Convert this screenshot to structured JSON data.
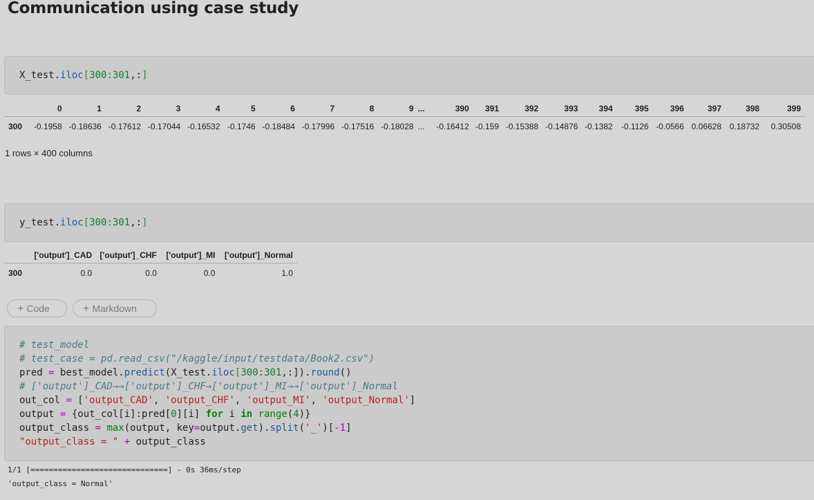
{
  "heading": "Communication using case study",
  "cell1": {
    "code": {
      "obj": "X_test.",
      "fn": "iloc",
      "lb": "[",
      "n1": "300",
      "c": ":",
      "n2": "301",
      "rest": ",:",
      "rb": "]"
    }
  },
  "table1": {
    "columns": [
      "",
      "0",
      "1",
      "2",
      "3",
      "4",
      "5",
      "6",
      "7",
      "8",
      "9",
      "...",
      "390",
      "391",
      "392",
      "393",
      "394",
      "395",
      "396",
      "397",
      "398",
      "399"
    ],
    "row_index": "300",
    "values": [
      "-0.1958",
      "-0.18636",
      "-0.17612",
      "-0.17044",
      "-0.16532",
      "-0.1746",
      "-0.18484",
      "-0.17996",
      "-0.17516",
      "-0.18028",
      "...",
      "-0.16412",
      "-0.159",
      "-0.15388",
      "-0.14876",
      "-0.1382",
      "-0.1126",
      "-0.0566",
      "0.06628",
      "0.18732",
      "0.30508"
    ],
    "shape": "1 rows × 400 columns"
  },
  "cell2": {
    "code": {
      "obj": "y_test.",
      "fn": "iloc",
      "lb": "[",
      "n1": "300",
      "c": ":",
      "n2": "301",
      "rest": ",:",
      "rb": "]"
    }
  },
  "table2": {
    "columns": [
      "",
      "['output']_CAD",
      "['output']_CHF",
      "['output']_MI",
      "['output']_Normal"
    ],
    "row_index": "300",
    "values": [
      "0.0",
      "0.0",
      "0.0",
      "1.0"
    ]
  },
  "add_buttons": {
    "plus": "+",
    "code": "Code",
    "markdown": "Markdown"
  },
  "cell3": {
    "l1": "# test_model",
    "l2": "# test_case = pd.read_csv(\"/kaggle/input/testdata/Book2.csv\")",
    "l3": {
      "a": "pred ",
      "eq": "=",
      "b": " best_model.",
      "f1": "predict",
      "c": "(X_test.",
      "f2": "iloc",
      "d": "[",
      "n1": "300",
      "e": ":",
      "n2": "301",
      "f": ",:]).",
      "f3": "round",
      "g": "()"
    },
    "l4": "# ['output']_CAD→→['output']_CHF→['output']_MI→→['output']_Normal",
    "l5": {
      "a": "out_col ",
      "eq": "=",
      "b": " [",
      "s1": "'output_CAD'",
      "c1": ", ",
      "s2": "'output_CHF'",
      "c2": ", ",
      "s3": "'output_MI'",
      "c3": ", ",
      "s4": "'output_Normal'",
      "d": "]"
    },
    "l6": {
      "a": "output ",
      "eq": "=",
      "b": " {out_col[i]:pred[",
      "n0": "0",
      "c": "][i] ",
      "kw1": "for",
      "d": " i ",
      "kw2": "in",
      "e": " ",
      "f": "range",
      "g": "(",
      "n4": "4",
      "h": ")}"
    },
    "l7": {
      "a": "output_class ",
      "eq": "=",
      "b": " ",
      "f1": "max",
      "c": "(output, key",
      "eq2": "=",
      "d": "output.",
      "f2": "get",
      "e": ").",
      "f3": "split",
      "g": "(",
      "s": "'_'",
      "h": ")[",
      "m": "-1",
      "i": "]"
    },
    "l8": {
      "s": "\"output_class = \"",
      "b": " ",
      "op": "+",
      "c": " output_class"
    }
  },
  "outputs": {
    "progress": "1/1 [==============================] - 0s 36ms/step",
    "result": "'output_class = Normal'"
  }
}
